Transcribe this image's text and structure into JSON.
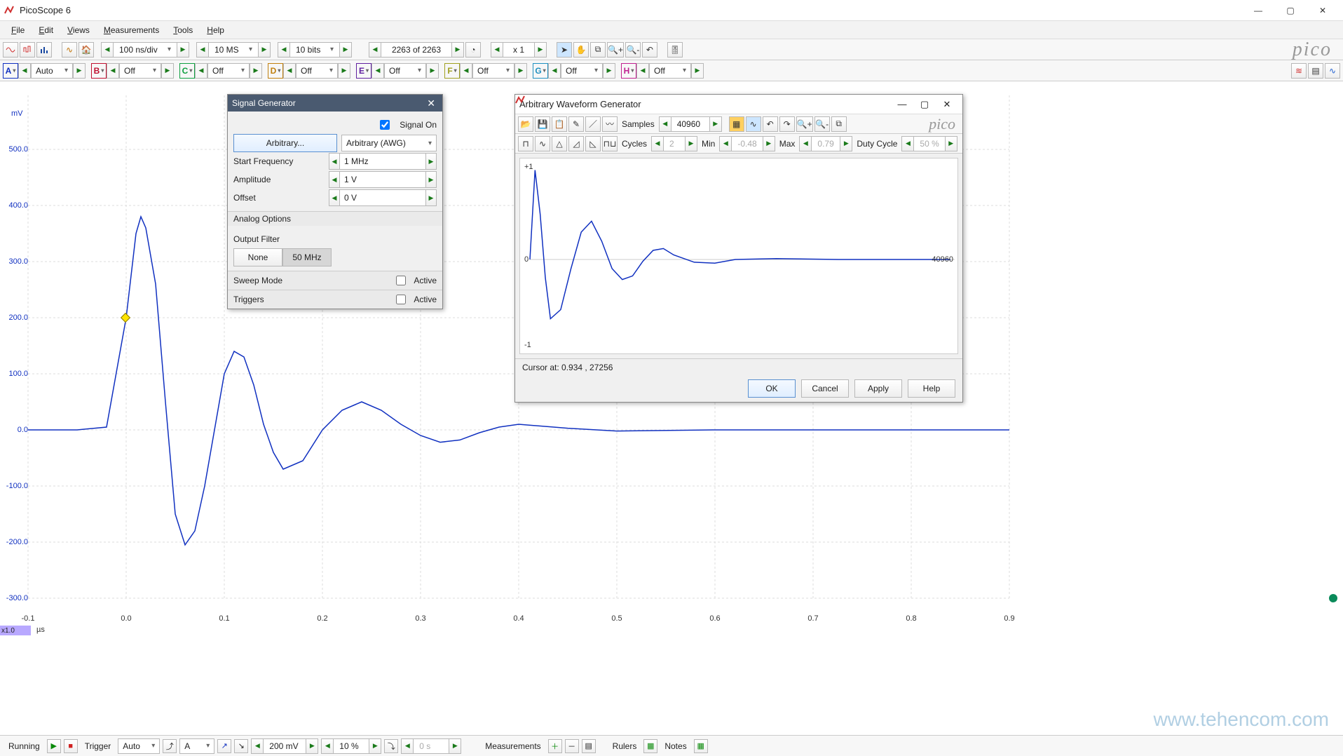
{
  "window": {
    "title": "PicoScope 6",
    "watermark": "www.tehencom.com",
    "brand": "pico"
  },
  "menu": [
    "File",
    "Edit",
    "Views",
    "Measurements",
    "Tools",
    "Help"
  ],
  "toolbar_top": {
    "timebase": "100 ns/div",
    "samples": "10 MS",
    "resolution": "10 bits",
    "buffer_status": "2263 of 2263",
    "zoom": "x 1"
  },
  "channels": [
    {
      "id": "A",
      "color": "#1030c0",
      "value": "Auto"
    },
    {
      "id": "B",
      "color": "#c01030",
      "value": "Off"
    },
    {
      "id": "C",
      "color": "#10a040",
      "value": "Off"
    },
    {
      "id": "D",
      "color": "#c08010",
      "value": "Off"
    },
    {
      "id": "E",
      "color": "#6020a0",
      "value": "Off"
    },
    {
      "id": "F",
      "color": "#a0a020",
      "value": "Off"
    },
    {
      "id": "G",
      "color": "#2090c0",
      "value": "Off"
    },
    {
      "id": "H",
      "color": "#c02090",
      "value": "Off"
    }
  ],
  "y_axis": {
    "unit": "mV",
    "ticks": [
      {
        "v": "500.0",
        "y": 97
      },
      {
        "v": "400.0",
        "y": 177
      },
      {
        "v": "300.0",
        "y": 257
      },
      {
        "v": "200.0",
        "y": 337
      },
      {
        "v": "100.0",
        "y": 417
      },
      {
        "v": "0.0",
        "y": 497
      },
      {
        "v": "-100.0",
        "y": 577
      },
      {
        "v": "-200.0",
        "y": 657
      },
      {
        "v": "-300.0",
        "y": 737
      }
    ]
  },
  "x_axis": {
    "unit": "µs",
    "zoom_badge": "x1.0",
    "ticks": [
      {
        "v": "-0.1",
        "x": 40
      },
      {
        "v": "0.0",
        "x": 180
      },
      {
        "v": "0.1",
        "x": 320
      },
      {
        "v": "0.2",
        "x": 460
      },
      {
        "v": "0.3",
        "x": 600
      },
      {
        "v": "0.4",
        "x": 740
      },
      {
        "v": "0.5",
        "x": 880
      },
      {
        "v": "0.6",
        "x": 1020
      },
      {
        "v": "0.7",
        "x": 1160
      },
      {
        "v": "0.8",
        "x": 1300
      },
      {
        "v": "0.9",
        "x": 1440
      }
    ]
  },
  "siggen": {
    "title": "Signal Generator",
    "signal_on_label": "Signal On",
    "signal_on": true,
    "arbitrary_btn": "Arbitrary...",
    "waveform_type": "Arbitrary (AWG)",
    "fields": [
      {
        "label": "Start Frequency",
        "value": "1 MHz"
      },
      {
        "label": "Amplitude",
        "value": "1 V"
      },
      {
        "label": "Offset",
        "value": "0 V"
      }
    ],
    "analog_options": "Analog Options",
    "output_filter_label": "Output Filter",
    "filter_none": "None",
    "filter_50": "50 MHz",
    "sweep_label": "Sweep Mode",
    "triggers_label": "Triggers",
    "active_label": "Active"
  },
  "awg": {
    "title": "Arbitrary Waveform Generator",
    "samples_label": "Samples",
    "samples_value": "40960",
    "cycles_label": "Cycles",
    "cycles_value": "2",
    "min_label": "Min",
    "min_value": "-0.48",
    "max_label": "Max",
    "max_value": "0.79",
    "duty_label": "Duty Cycle",
    "duty_value": "50 %",
    "cursor": "Cursor at: 0.934 , 27256",
    "ok": "OK",
    "cancel": "Cancel",
    "apply": "Apply",
    "help": "Help",
    "y_top": "+1",
    "y_mid": "0",
    "y_bot": "-1",
    "x_right": "40960",
    "brand": "pico"
  },
  "statusbar": {
    "running": "Running",
    "trigger_label": "Trigger",
    "trigger_mode": "Auto",
    "trigger_source": "A",
    "trigger_level": "200 mV",
    "trigger_pct": "10 %",
    "pretrig": "0 s",
    "measurements": "Measurements",
    "rulers": "Rulers",
    "notes": "Notes"
  },
  "chart_data": {
    "main_scope": {
      "type": "line",
      "xlabel": "µs",
      "ylabel": "mV",
      "xlim": [
        -0.1,
        0.9
      ],
      "ylim": [
        -300,
        500
      ],
      "x": [
        -0.1,
        -0.05,
        -0.02,
        0.0,
        0.01,
        0.015,
        0.02,
        0.03,
        0.04,
        0.05,
        0.06,
        0.07,
        0.08,
        0.09,
        0.1,
        0.11,
        0.12,
        0.13,
        0.14,
        0.15,
        0.16,
        0.18,
        0.2,
        0.22,
        0.24,
        0.26,
        0.28,
        0.3,
        0.32,
        0.34,
        0.36,
        0.38,
        0.4,
        0.45,
        0.5,
        0.6,
        0.7,
        0.8,
        0.9
      ],
      "y": [
        0,
        0,
        5,
        200,
        350,
        380,
        360,
        260,
        50,
        -150,
        -205,
        -180,
        -100,
        0,
        100,
        140,
        130,
        80,
        10,
        -40,
        -70,
        -55,
        0,
        35,
        50,
        35,
        10,
        -10,
        -22,
        -18,
        -5,
        5,
        10,
        3,
        -2,
        0,
        0,
        0,
        0
      ],
      "title": "Oscilloscope Channel A"
    },
    "awg_preview": {
      "type": "line",
      "xlim": [
        0,
        40960
      ],
      "ylim": [
        -1,
        1
      ],
      "x": [
        0,
        500,
        1000,
        1500,
        2000,
        3000,
        4000,
        5000,
        6000,
        7000,
        8000,
        9000,
        10000,
        11000,
        12000,
        13000,
        14000,
        16000,
        18000,
        20000,
        24000,
        30000,
        40960
      ],
      "y": [
        0,
        0.98,
        0.5,
        -0.2,
        -0.65,
        -0.55,
        -0.1,
        0.3,
        0.42,
        0.2,
        -0.1,
        -0.22,
        -0.18,
        -0.02,
        0.1,
        0.12,
        0.05,
        -0.03,
        -0.04,
        0.0,
        0.01,
        0.0,
        0.0
      ],
      "title": "Arbitrary waveform preview"
    }
  }
}
